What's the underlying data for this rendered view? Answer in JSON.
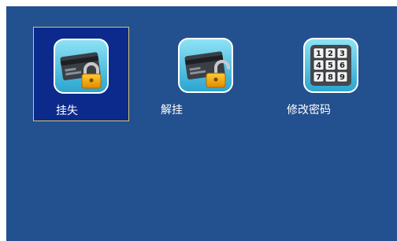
{
  "menu": {
    "items": [
      {
        "label": "挂失",
        "icon": "card-lock-icon",
        "selected": true
      },
      {
        "label": "解挂",
        "icon": "card-unlock-icon",
        "selected": false
      },
      {
        "label": "修改密码",
        "icon": "keypad-icon",
        "selected": false
      }
    ],
    "keypad_digits": [
      "1",
      "2",
      "3",
      "4",
      "5",
      "6",
      "7",
      "8",
      "9"
    ]
  },
  "colors": {
    "screen_background": "#23508f",
    "selected_tile": "#0b2a8c",
    "selected_border": "#d8c76a",
    "label_text": "#ffffff"
  }
}
